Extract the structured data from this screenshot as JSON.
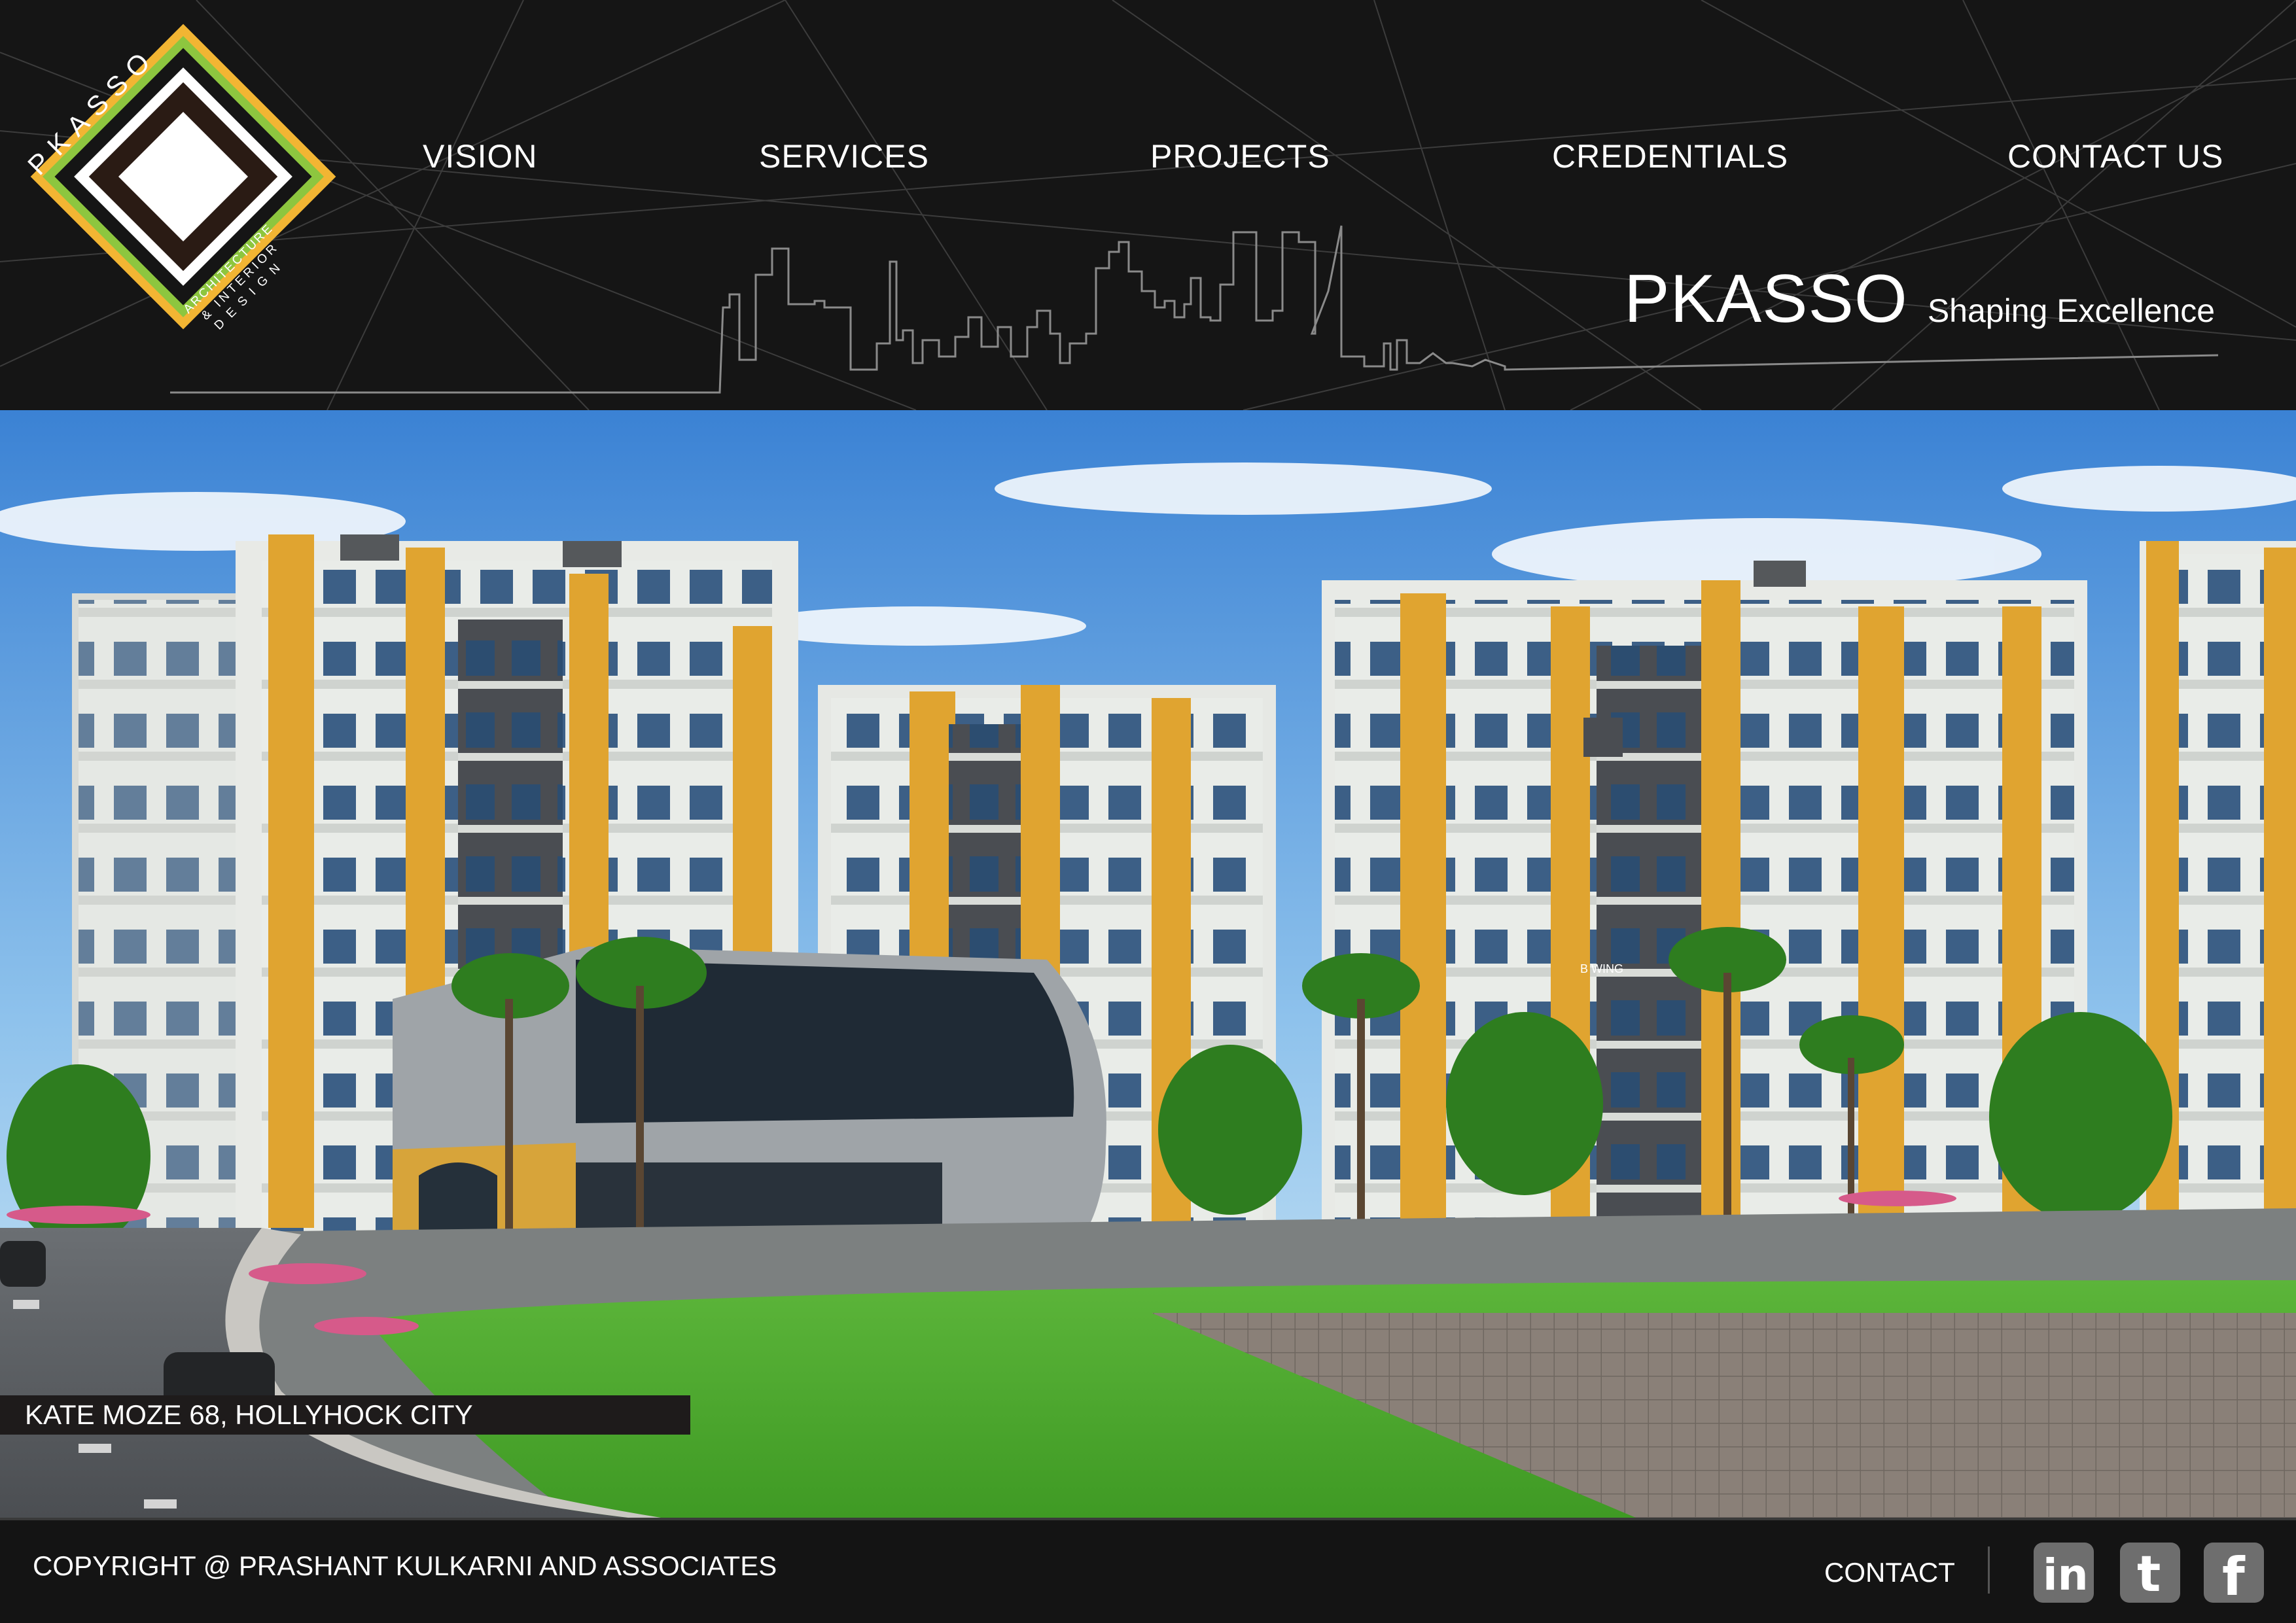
{
  "brand": {
    "logo_text": "PKASSO",
    "logo_subtitle_1": "ARCHITECTURE",
    "logo_subtitle_2": "& INTERIOR",
    "logo_subtitle_3": "DESIGN",
    "name": "PKASSO",
    "tagline": "Shaping Excellence"
  },
  "nav": {
    "items": [
      {
        "label": "VISION"
      },
      {
        "label": "SERVICES"
      },
      {
        "label": "PROJECTS"
      },
      {
        "label": "CREDENTIALS"
      },
      {
        "label": "CONTACT US"
      }
    ]
  },
  "hero": {
    "caption": "KATE MOZE 68, HOLLYHOCK CITY",
    "wing_sign": "B WING"
  },
  "footer": {
    "copyright": "COPYRIGHT @ PRASHANT KULKARNI AND ASSOCIATES",
    "contact_label": "CONTACT",
    "social": [
      {
        "icon": "linkedin-icon",
        "glyph": "in"
      },
      {
        "icon": "twitter-icon",
        "glyph": "t"
      },
      {
        "icon": "facebook-icon",
        "glyph": "f"
      }
    ]
  },
  "colors": {
    "header_bg": "#151515",
    "logo_green": "#8dc63f",
    "logo_yellow": "#f2b533",
    "building_accent": "#e0a430",
    "sky_top": "#3f86d6",
    "lawn": "#4fae2e",
    "social_bg": "#6e6e6e"
  }
}
